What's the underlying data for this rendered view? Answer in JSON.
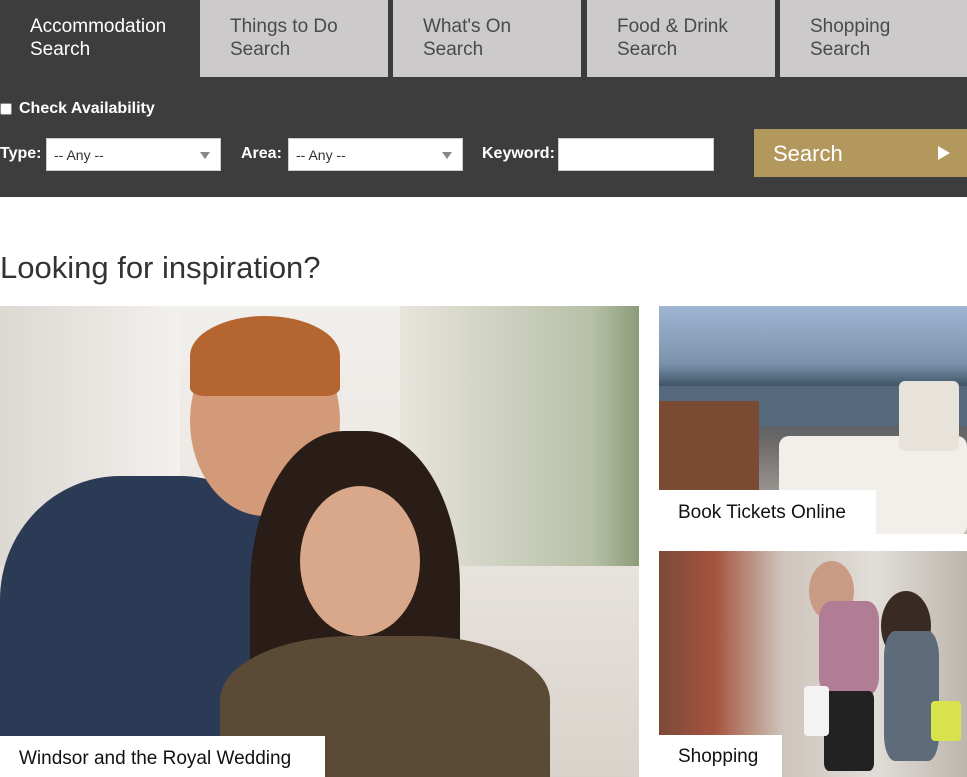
{
  "tabs": [
    {
      "line1": "Accommodation",
      "line2": "Search",
      "active": true
    },
    {
      "line1": "Things to Do",
      "line2": "Search",
      "active": false
    },
    {
      "line1": "What's On",
      "line2": "Search",
      "active": false
    },
    {
      "line1": "Food & Drink",
      "line2": "Search",
      "active": false
    },
    {
      "line1": "Shopping",
      "line2": "Search",
      "active": false
    }
  ],
  "search": {
    "check_availability_label": "Check Availability",
    "type_label": "Type:",
    "type_value": "-- Any --",
    "area_label": "Area:",
    "area_value": "-- Any --",
    "keyword_label": "Keyword:",
    "keyword_value": "",
    "button_label": "Search"
  },
  "inspiration": {
    "heading": "Looking for inspiration?",
    "cards": [
      {
        "caption": "Windsor and the Royal Wedding"
      },
      {
        "caption": "Book Tickets Online"
      },
      {
        "caption": "Shopping"
      }
    ]
  },
  "colors": {
    "panel_bg": "#3d3d3d",
    "tab_inactive_bg": "#cdcacb",
    "search_button": "#b3985d"
  }
}
